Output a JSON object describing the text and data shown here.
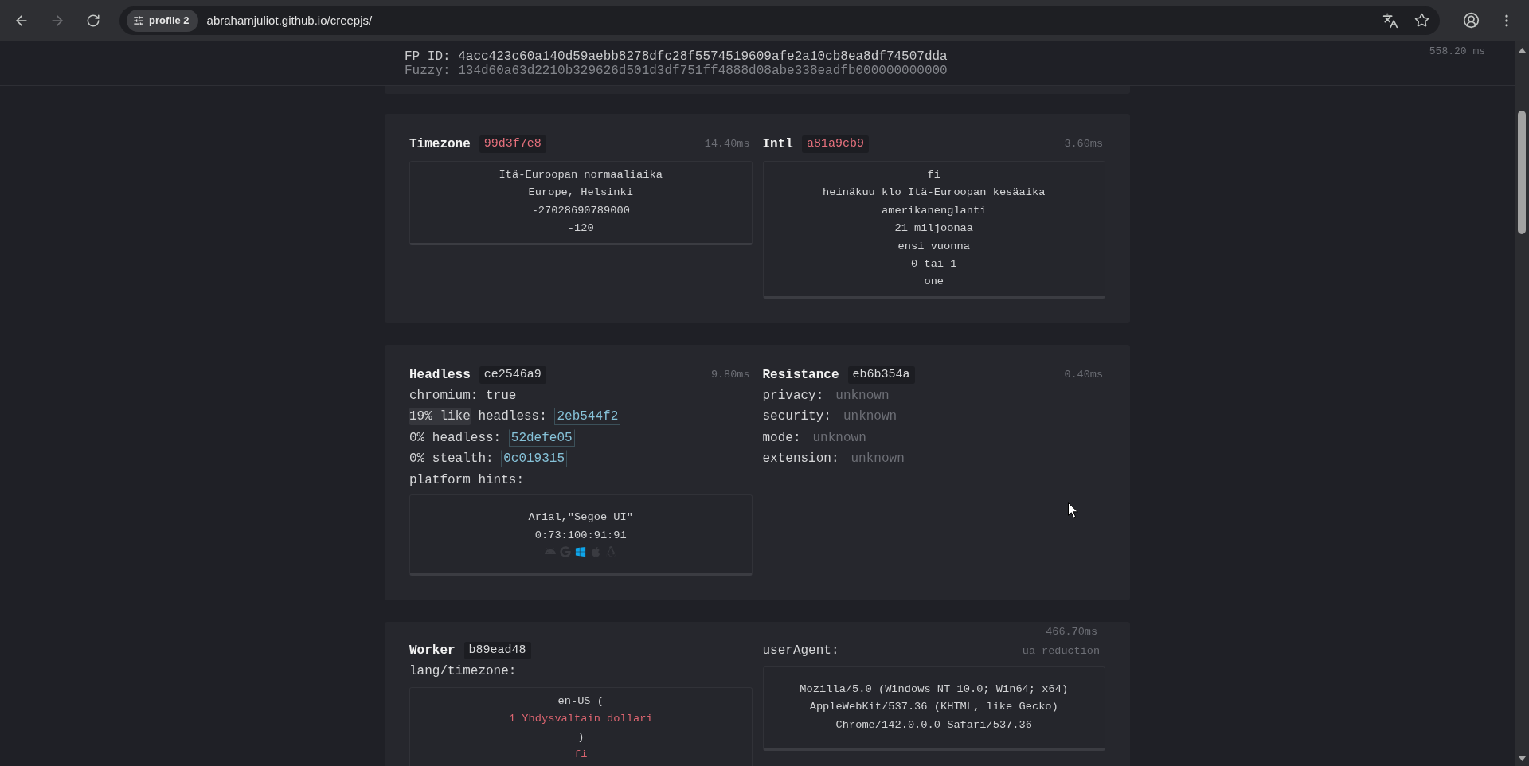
{
  "browser": {
    "back_disabled": false,
    "forward_disabled": true,
    "profile": "profile 2",
    "url": "abrahamjuliot.github.io/creepjs/"
  },
  "fingerprint": {
    "fp_id": "FP ID: 4acc423c60a140d59aebb8278dfc28f5574519609afe2a10cb8ea8df74507dda",
    "fuzzy": "Fuzzy: 134d60a63d2210b329626d501d3df751ff4888d08abe338eadfb000000000000",
    "time": "558.20 ms"
  },
  "cards": [
    {
      "sections": [
        {
          "kind": "boxed",
          "title": "Timezone",
          "hash": "99d3f7e8",
          "hash_flagged": true,
          "time": "14.40ms",
          "box": [
            {
              "text": "Itä-Euroopan normaaliaika",
              "flagged": false
            },
            {
              "text": "Europe, Helsinki",
              "flagged": false
            },
            {
              "text": "-27028690789000",
              "flagged": false
            },
            {
              "text": "-120",
              "flagged": false
            }
          ]
        },
        {
          "kind": "boxed",
          "title": "Intl",
          "hash": "a81a9cb9",
          "hash_flagged": true,
          "time": "3.60ms",
          "box": [
            {
              "text": "fi",
              "flagged": false
            },
            {
              "text": "heinäkuu klo Itä-Euroopan kesäaika",
              "flagged": false
            },
            {
              "text": "amerikanenglanti",
              "flagged": false
            },
            {
              "text": "21 miljoonaa",
              "flagged": false
            },
            {
              "text": "ensi vuonna",
              "flagged": false
            },
            {
              "text": "0 tai 1",
              "flagged": false
            },
            {
              "text": "one",
              "flagged": false
            }
          ]
        }
      ]
    },
    {
      "sections": [
        {
          "kind": "headless",
          "title": "Headless",
          "hash": "ce2546a9",
          "hash_flagged": false,
          "time": "9.80ms",
          "lines": [
            {
              "kind": "text",
              "text": "chromium: true"
            },
            {
              "kind": "score",
              "score": "19% like",
              "highlighted": true,
              "label": "headless:",
              "link": "2eb544f2"
            },
            {
              "kind": "score",
              "score": "0%",
              "highlighted": false,
              "label": "headless:",
              "link": "52defe05"
            },
            {
              "kind": "score",
              "score": "0%",
              "highlighted": false,
              "label": "stealth:",
              "link": "0c019315"
            },
            {
              "kind": "text",
              "text": "platform hints:"
            }
          ],
          "platform_hints": {
            "fonts": "Arial,\"Segoe UI\"",
            "values": "0:73:100:91:91",
            "platforms": [
              {
                "kind": "android",
                "selected": false
              },
              {
                "kind": "google",
                "selected": false
              },
              {
                "kind": "windows",
                "selected": true
              },
              {
                "kind": "apple",
                "selected": false
              },
              {
                "kind": "linux",
                "selected": false
              }
            ]
          }
        },
        {
          "kind": "fields",
          "title": "Resistance",
          "hash": "eb6b354a",
          "hash_flagged": false,
          "time": "0.40ms",
          "fields": [
            {
              "label": "privacy:",
              "value": "unknown"
            },
            {
              "label": "security:",
              "value": "unknown"
            },
            {
              "label": "mode:",
              "value": "unknown"
            },
            {
              "label": "extension:",
              "value": "unknown"
            }
          ]
        }
      ]
    },
    {
      "time": "466.70ms",
      "sections": [
        {
          "kind": "worker",
          "title": "Worker",
          "hash": "b89ead48",
          "hash_flagged": false,
          "label": "lang/timezone:",
          "box": [
            {
              "text": "en-US (",
              "flagged": false
            },
            {
              "text": "1 Yhdysvaltain dollari",
              "flagged": true
            },
            {
              "text": ")",
              "flagged": false
            },
            {
              "text": "fi",
              "flagged": true
            }
          ]
        },
        {
          "kind": "useragent",
          "label": "userAgent:",
          "note": "ua reduction",
          "box": [
            {
              "text": "Mozilla/5.0 (Windows NT 10.0; Win64; x64)",
              "flagged": false
            },
            {
              "text": "AppleWebKit/537.36 (KHTML, like Gecko)",
              "flagged": false
            },
            {
              "text": "Chrome/142.0.0.0 Safari/537.36",
              "flagged": false
            }
          ]
        }
      ]
    }
  ]
}
